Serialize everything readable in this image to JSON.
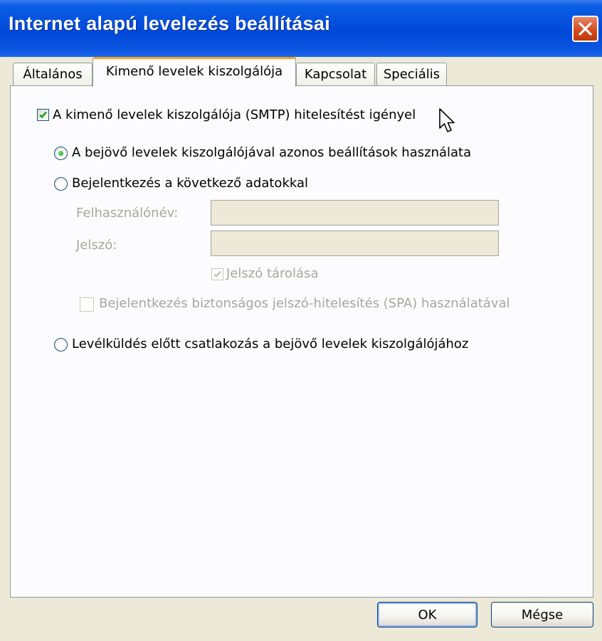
{
  "window": {
    "title": "Internet alapú levelezés beállításai",
    "close_icon": "close-icon"
  },
  "tabs": [
    {
      "label": "Általános",
      "active": false
    },
    {
      "label": "Kimenő levelek kiszolgálója",
      "active": true
    },
    {
      "label": "Kapcsolat",
      "active": false
    },
    {
      "label": "Speciális",
      "active": false
    }
  ],
  "auth": {
    "require_smtp_auth_label": "A kimenő levelek kiszolgálója (SMTP) hitelesítést igényel",
    "require_smtp_auth_checked": true,
    "same_settings_label": "A bejövő levelek kiszolgálójával azonos beállítások használata",
    "same_settings_selected": true,
    "login_with_label": "Bejelentkezés a következő adatokkal",
    "login_with_selected": false,
    "username_label": "Felhasználónév:",
    "username_value": "",
    "password_label": "Jelszó:",
    "password_value": "",
    "remember_password_label": "Jelszó tárolása",
    "remember_password_checked": true,
    "spa_label": "Bejelentkezés biztonságos jelszó-hitelesítés (SPA) használatával",
    "spa_checked": false,
    "pop_before_smtp_label": "Levélküldés előtt csatlakozás a bejövő levelek kiszolgálójához",
    "pop_before_smtp_selected": false
  },
  "buttons": {
    "ok_label": "OK",
    "cancel_label": "Mégse"
  },
  "colors": {
    "titlebar": "#0048d8",
    "dialog_bg": "#ece9d8",
    "panel_bg": "#fcfcfe",
    "active_tab_accent": "#f7a21b",
    "close_button": "#d4481c",
    "check_green": "#21a121",
    "disabled_text": "#a7a6a0"
  }
}
